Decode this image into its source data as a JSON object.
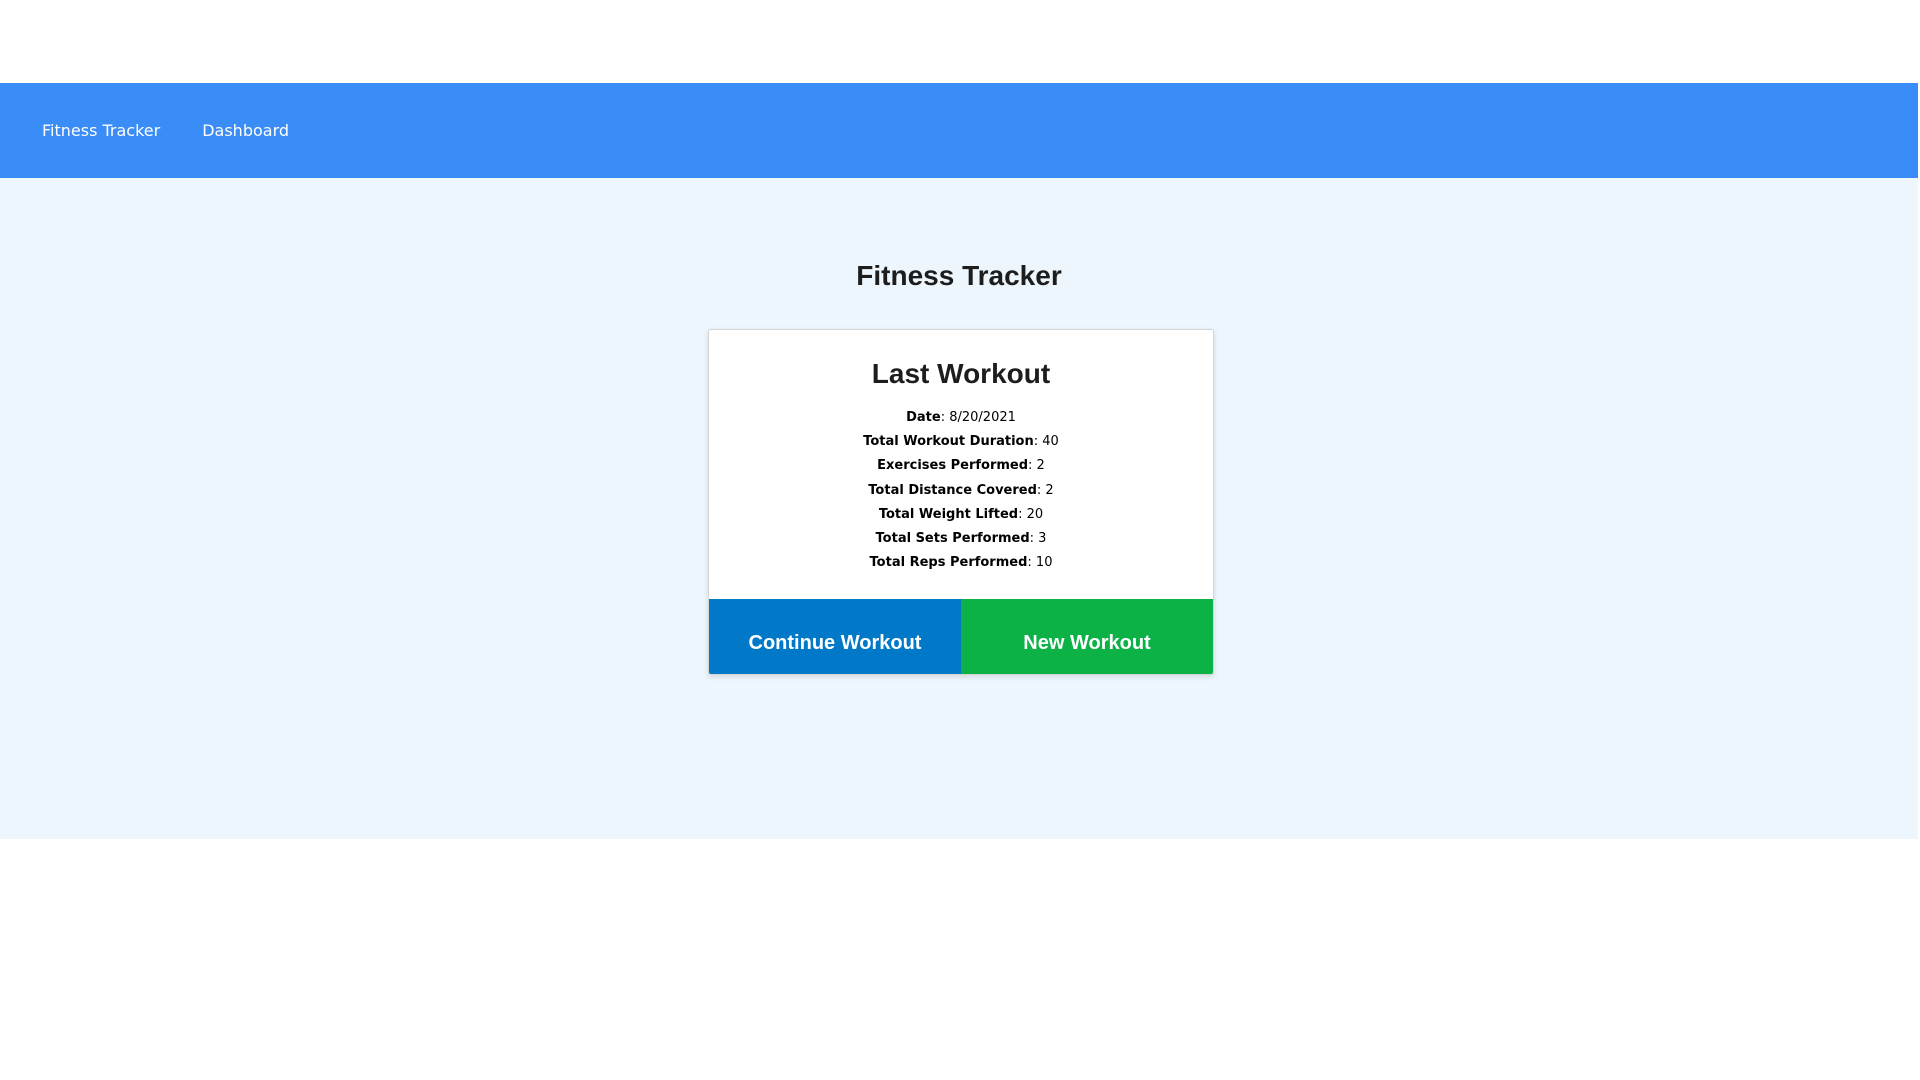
{
  "nav": {
    "items": [
      {
        "label": "Fitness Tracker"
      },
      {
        "label": "Dashboard"
      }
    ]
  },
  "main": {
    "title": "Fitness Tracker"
  },
  "card": {
    "title": "Last Workout",
    "stats": [
      {
        "label": "Date",
        "value": ": 8/20/2021"
      },
      {
        "label": "Total Workout Duration",
        "value": ": 40"
      },
      {
        "label": "Exercises Performed",
        "value": ": 2"
      },
      {
        "label": "Total Distance Covered",
        "value": ": 2"
      },
      {
        "label": "Total Weight Lifted",
        "value": ": 20"
      },
      {
        "label": "Total Sets Performed",
        "value": ": 3"
      },
      {
        "label": "Total Reps Performed",
        "value": ": 10"
      }
    ],
    "buttons": {
      "continue_label": "Continue Workout",
      "new_label": "New Workout"
    }
  },
  "colors": {
    "navbar": "#3a8cf6",
    "background": "#eef6fd",
    "continue_button": "#0179c8",
    "new_button": "#0cb246"
  }
}
